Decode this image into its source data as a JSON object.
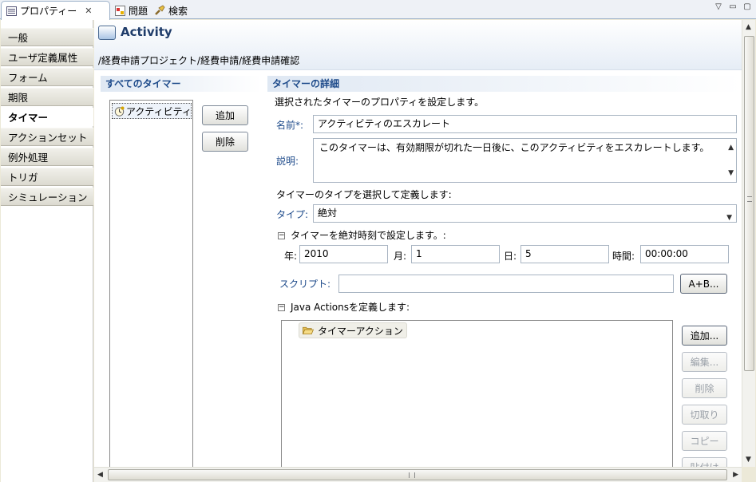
{
  "tabs": {
    "properties": "プロパティー",
    "problems": "問題",
    "search": "検索",
    "close_glyph": "✕"
  },
  "categories": [
    "一般",
    "ユーザ定義属性",
    "フォーム",
    "期限",
    "タイマー",
    "アクションセット",
    "例外処理",
    "トリガ",
    "シミュレーション"
  ],
  "selected_category": "タイマー",
  "header": {
    "title": "Activity",
    "path": "/経費申請プロジェクト/経費申請/経費申請確認"
  },
  "timers": {
    "section_title": "すべてのタイマー",
    "items": [
      "アクティビティ"
    ],
    "add_label": "追加",
    "delete_label": "削除"
  },
  "details": {
    "section_title": "タイマーの詳細",
    "intro": "選択されたタイマーのプロパティを設定します。",
    "name_label": "名前*:",
    "name_value": "アクティビティのエスカレート",
    "desc_label": "説明:",
    "desc_value": "このタイマーは、有効期限が切れた一日後に、このアクティビティをエスカレートします。",
    "type_prompt": "タイマーのタイプを選択して定義します:",
    "type_label": "タイプ:",
    "type_value": "絶対",
    "absolute_section": "タイマーを絶対時刻で設定します。:",
    "year_label": "年:",
    "year_value": "2010",
    "month_label": "月:",
    "month_value": "1",
    "day_label": "日:",
    "day_value": "5",
    "time_label": "時間:",
    "time_value": "00:00:00",
    "script_label": "スクリプト:",
    "script_value": "",
    "script_button": "A+B...",
    "java_section": "Java Actionsを定義します:",
    "java_tree_item": "タイマーアクション",
    "java_buttons": [
      "追加...",
      "編集...",
      "削除",
      "切取り",
      "コピー",
      "貼付け"
    ]
  },
  "colors": {
    "accent": "#1d4a8a",
    "header_gradient_end": "#e6edf6"
  }
}
